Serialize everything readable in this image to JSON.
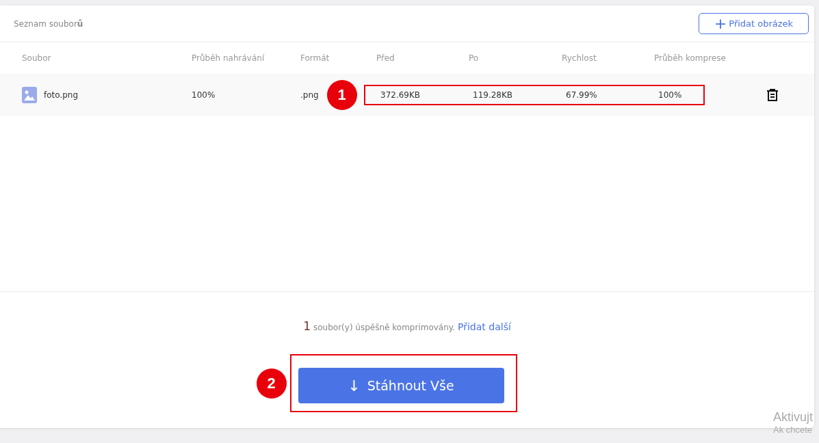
{
  "panel": {
    "title": "Seznam soubor**ů**",
    "add_button": {
      "icon": "+",
      "label": "Přidat obrázek"
    }
  },
  "table": {
    "columns": [
      "Soubor",
      "Průběh nahrávání",
      "Formát",
      "Před",
      "Po",
      "Rychlost",
      "Průběh komprese"
    ],
    "rows": [
      {
        "file": "foto.png",
        "upload_progress": "100%",
        "format": ".png",
        "before": "372.69KB",
        "after": "119.28KB",
        "ratio": "67.99%",
        "compress_progress": "100%"
      }
    ]
  },
  "summary": {
    "count": "1",
    "text": "soubor(y) úspěšně komprimovány.",
    "link": "Přidat další"
  },
  "download_button": {
    "icon": "↓",
    "label": "Stáhnout Vše"
  },
  "annotations": [
    {
      "label": "1"
    },
    {
      "label": "2"
    }
  ],
  "os_notice": {
    "title": "Aktivujt",
    "subtitle": "Ak chcete"
  }
}
